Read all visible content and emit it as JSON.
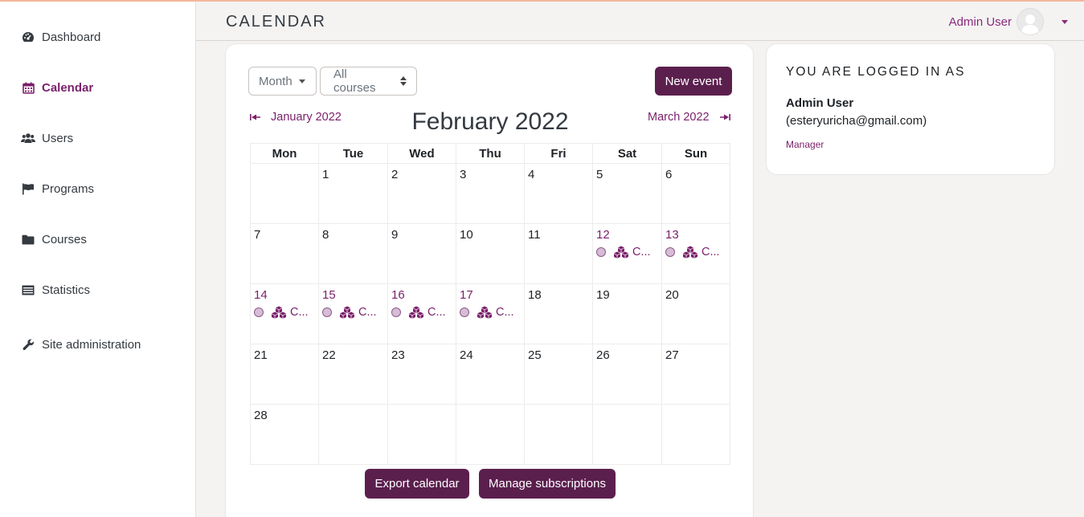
{
  "colors": {
    "accent": "#7a1f6a",
    "button": "#5b1f4e"
  },
  "sidebar": {
    "items": [
      {
        "label": "Dashboard",
        "icon": "dashboard-icon",
        "active": false
      },
      {
        "label": "Calendar",
        "icon": "calendar-icon",
        "active": true
      },
      {
        "label": "Users",
        "icon": "users-icon",
        "active": false
      },
      {
        "label": "Programs",
        "icon": "flag-icon",
        "active": false
      },
      {
        "label": "Courses",
        "icon": "folder-icon",
        "active": false
      },
      {
        "label": "Statistics",
        "icon": "statistics-icon",
        "active": false
      },
      {
        "label": "Site administration",
        "icon": "wrench-icon",
        "active": false
      }
    ]
  },
  "header": {
    "title": "CALENDAR",
    "user_name": "Admin User"
  },
  "calendar": {
    "view_select": "Month",
    "course_select": "All courses",
    "new_event_label": "New event",
    "prev_month": "January 2022",
    "current_month": "February 2022",
    "next_month": "March 2022",
    "weekdays": [
      "Mon",
      "Tue",
      "Wed",
      "Thu",
      "Fri",
      "Sat",
      "Sun"
    ],
    "weeks": [
      [
        null,
        1,
        2,
        3,
        4,
        5,
        6
      ],
      [
        7,
        8,
        9,
        10,
        11,
        12,
        13
      ],
      [
        14,
        15,
        16,
        17,
        18,
        19,
        20
      ],
      [
        21,
        22,
        23,
        24,
        25,
        26,
        27
      ],
      [
        28,
        null,
        null,
        null,
        null,
        null,
        null
      ]
    ],
    "event_days": [
      12,
      13,
      14,
      15,
      16,
      17
    ],
    "event_label": "C...",
    "export_label": "Export calendar",
    "manage_label": "Manage subscriptions"
  },
  "login_block": {
    "title": "YOU ARE LOGGED IN AS",
    "name": "Admin User",
    "email": "(esteryuricha@gmail.com)",
    "role": "Manager"
  }
}
